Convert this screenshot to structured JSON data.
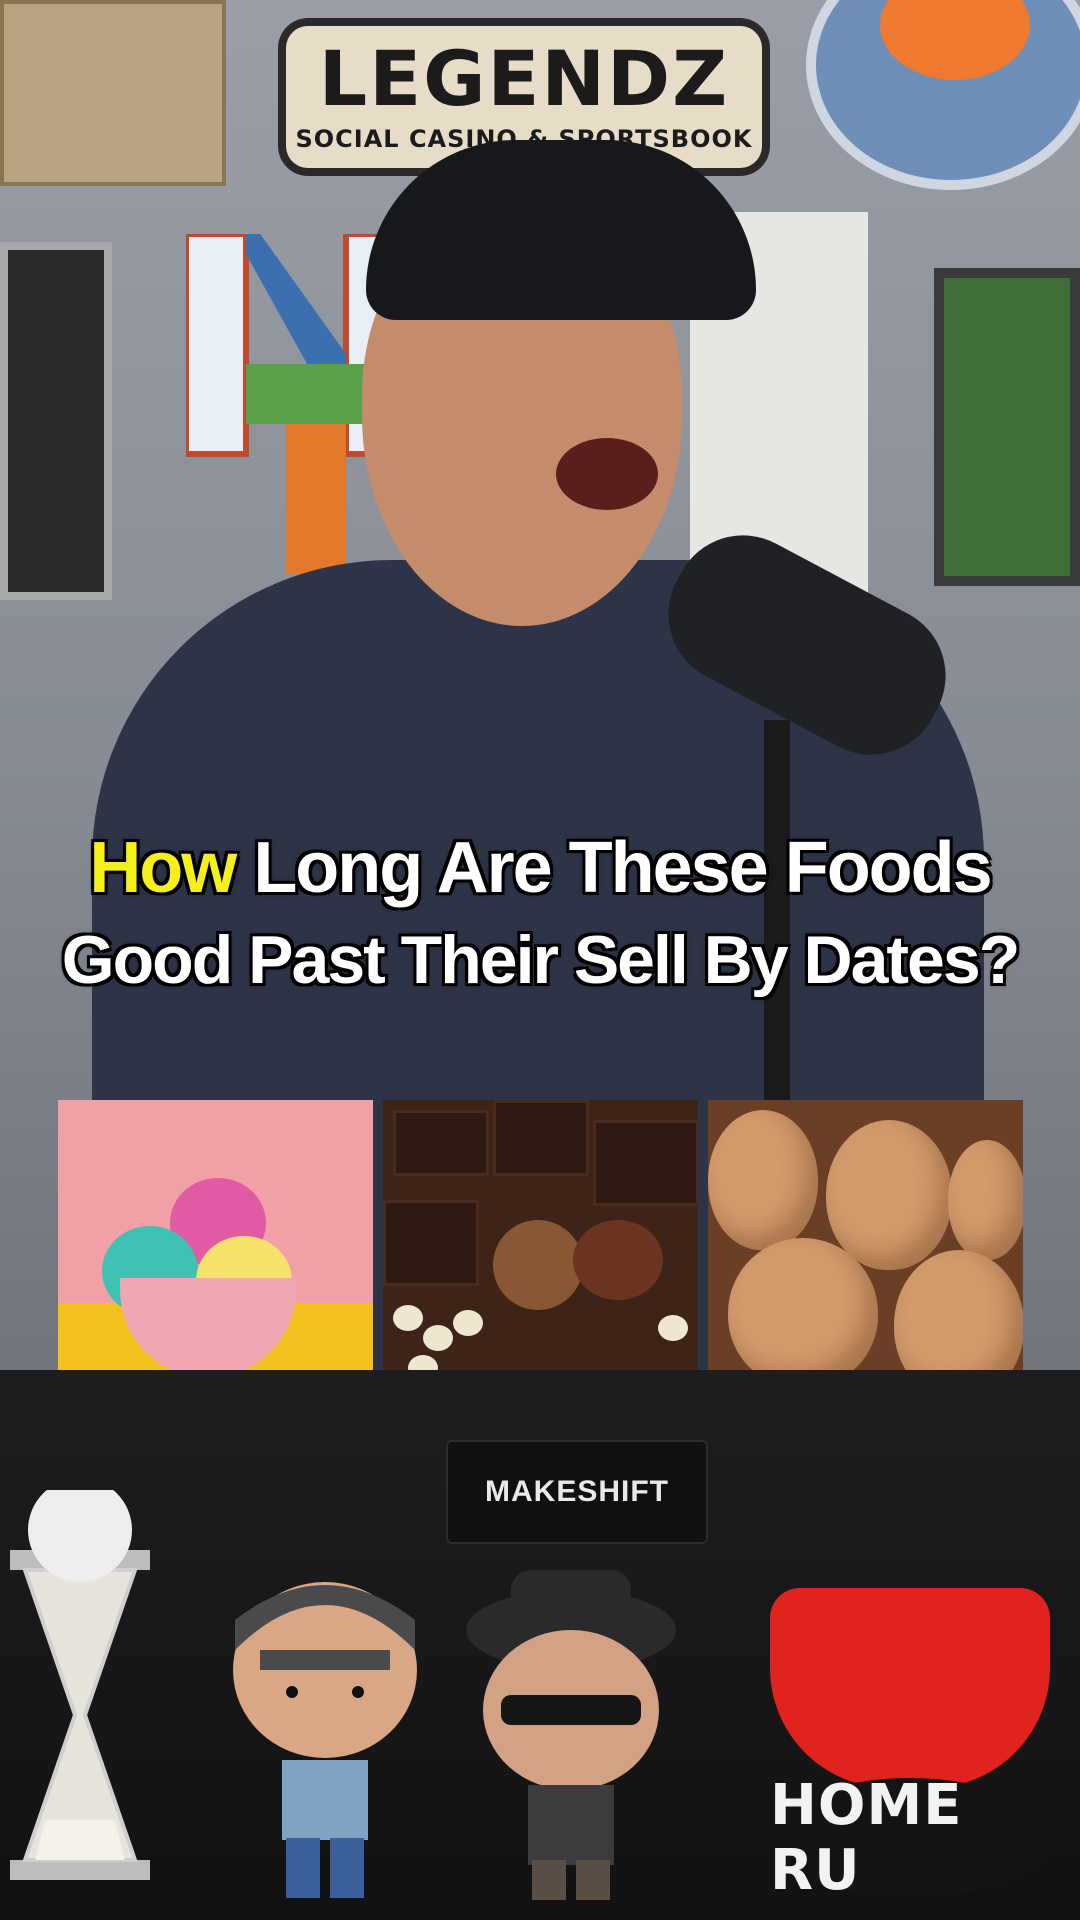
{
  "caption": {
    "highlight_word": "How",
    "line1_rest": "Long Are These Foods",
    "line2": "Good Past Their Sell By Dates?"
  },
  "background_sign": {
    "title": "LEGENDZ",
    "subtitle": "SOCIAL CASINO & SPORTSBOOK"
  },
  "desk_logo": {
    "text": "MAKESHIFT"
  },
  "base_text": "HOME RU",
  "food_images": [
    "ice cream",
    "chocolate",
    "eggs"
  ],
  "colors": {
    "caption_text": "#ffffff",
    "caption_highlight": "#f5f01c",
    "caption_outline": "#000000"
  }
}
